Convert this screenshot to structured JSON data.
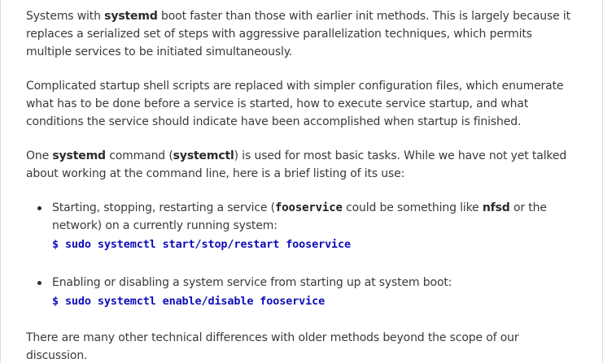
{
  "p1": {
    "t1": "Systems with ",
    "b1": "systemd",
    "t2": " boot faster than those with earlier init methods. This is largely because it replaces a serialized set of steps with aggressive parallelization techniques, which permits multiple services to be initiated simultaneously."
  },
  "p2": {
    "text": "Complicated startup shell scripts are replaced with simpler configuration files, which enumerate what has to be done before a service is started, how to execute service startup, and what conditions the service should indicate have been accomplished when startup is finished."
  },
  "p3": {
    "t1": "One ",
    "b1": "systemd",
    "t2": " command (",
    "b2": "systemctl",
    "t3": ") is used for most basic tasks. While we have not yet talked about working at the command line, here is a brief listing of its use:"
  },
  "bullets": [
    {
      "t1": "Starting, stopping, restarting a service (",
      "code1": "fooservice",
      "t2": " could be something like ",
      "b1": "nfsd",
      "t3": " or the network) on a currently running system:",
      "command": "$ sudo systemctl start/stop/restart fooservice"
    },
    {
      "t1": "Enabling or disabling a system service from starting up at system boot:",
      "command": "$ sudo systemctl enable/disable fooservice"
    }
  ],
  "p4": {
    "text": "There are many other technical differences with older methods beyond the scope of our discussion."
  },
  "colors": {
    "text": "#3a3a3a",
    "command": "#0d0db8",
    "border": "#dcdcdc"
  }
}
